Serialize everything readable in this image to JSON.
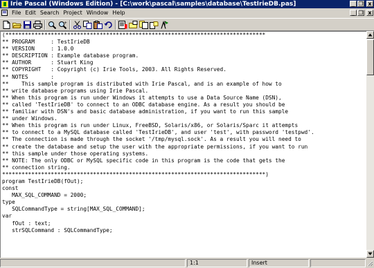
{
  "window": {
    "title": "Irie Pascal (Windows Edition) - [C:\\work\\pascal\\samples\\database\\TestIrieDB.pas]",
    "minimize": "_",
    "restore": "❐",
    "close": "x"
  },
  "menu": [
    "File",
    "Edit",
    "Search",
    "Project",
    "Window",
    "Help"
  ],
  "toolbar": [
    "new-file",
    "open-folder",
    "save",
    "print",
    "find",
    "find-next",
    "cut",
    "copy",
    "paste",
    "undo",
    "compile",
    "open-project",
    "project-files",
    "project-options",
    "run"
  ],
  "editor": {
    "lines": [
      "(********************************************************************************",
      "** PROGRAM     : TestIrieDB",
      "** VERSION     : 1.0.0",
      "** DESCRIPTION : Example database program.",
      "** AUTHOR      : Stuart King",
      "** COPYRIGHT   : Copyright (c) Irie Tools, 2003. All Rights Reserved.",
      "** NOTES       :",
      "**    This sample program is distributed with Irie Pascal, and is an example of how to",
      "** write database programs using Irie Pascal.",
      "** When this program is run under Windows it attempts to use a Data Source Name (DSN),",
      "** called 'TestIrieDB' to connect to an ODBC database engine. As a result you should be",
      "** familiar with DSN's and basic database administration, if you want to run this sample",
      "** under Windows.",
      "** When this program is run under Linux, FreeBSD, Solaris/x86, or Solaris/Sparc it attempts",
      "** to connect to a MySQL database called 'TestIrieDB', and user 'test', with password 'testpwd'.",
      "** The connection is made through the socket '/tmp/mysql.sock'. As a result you will need to",
      "** create the database and setup the user with the appropriate permissions, if you want to run",
      "** this sample under those operating systems.",
      "** NOTE: The only ODBC or MySQL specific code in this program is the code that gets the",
      "** connection string.",
      "*********************************************************************************)",
      "program TestIrieDB(fOut);",
      "const",
      "   MAX_SQL_COMMAND = 2000;",
      "type",
      "   SQLCommandType = string[MAX_SQL_COMMAND];",
      "var",
      "   fOut : text;",
      "   strSQLCommand : SQLCommandType;"
    ]
  },
  "status": {
    "position": "1:1",
    "mode": "Insert"
  }
}
